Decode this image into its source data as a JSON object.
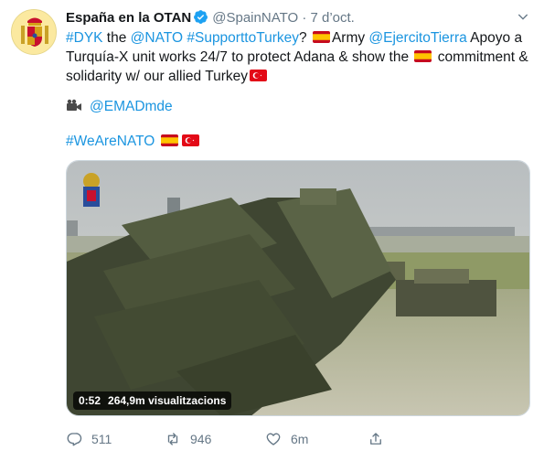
{
  "account": {
    "name": "España en la OTAN",
    "handle": "@SpainNATO",
    "separator": "·",
    "time": "7 d’oct."
  },
  "tweet": {
    "line1": {
      "t1": "#DYK",
      "t2": " the ",
      "t3": "@NATO",
      "t4": " ",
      "t5": "#SupporttoTurkey",
      "t6": "? ",
      "t7": "Army ",
      "t8": "@EjercitoTierra",
      "t9": " Apoyo a"
    },
    "line2": "Turquía-X unit works 24/7 to protect Adana & show the ",
    "line2_end": " commitment &",
    "line3": "solidarity w/ our allied Turkey",
    "mention": "@EMADmde",
    "hashtag": "#WeAreNATO"
  },
  "media": {
    "duration": "0:52",
    "views": "264,9m visualitzacions"
  },
  "actions": {
    "replies": "511",
    "retweets": "946",
    "likes": "6m"
  },
  "icons": {
    "verified": "verified-badge-icon",
    "more": "chevron-down-icon",
    "camera": "movie-camera-icon",
    "reply": "reply-icon",
    "retweet": "retweet-icon",
    "like": "heart-icon",
    "share": "share-icon"
  },
  "colors": {
    "link": "#1b95e0",
    "muted": "#657786",
    "text": "#14171a"
  }
}
